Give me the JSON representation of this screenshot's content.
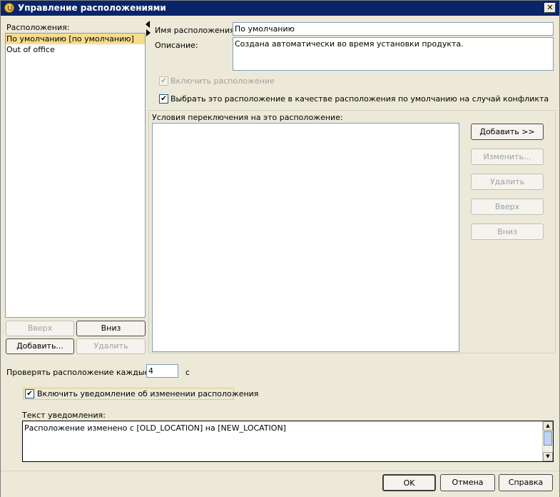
{
  "window": {
    "title": "Управление расположениями"
  },
  "locations": {
    "label": "Расположения:",
    "items": [
      "По умолчанию [по умолчанию]",
      "Out of office"
    ],
    "up_label": "Вверх",
    "down_label": "Вниз",
    "add_label": "Добавить...",
    "delete_label": "Удалить"
  },
  "details": {
    "name_label": "Имя расположения:",
    "name_value": "По умолчанию",
    "desc_label": "Описание:",
    "desc_value": "Создана автоматически во время установки продукта.",
    "enable_label": "Включить расположение",
    "enable_checked": "✔",
    "default_label": "Выбрать это расположение в качестве расположения по умолчанию на случай конфликта",
    "default_checked": "✔"
  },
  "conditions": {
    "label": "Условия переключения на это расположение:",
    "add_label": "Добавить >>",
    "edit_label": "Изменить...",
    "delete_label": "Удалить",
    "up_label": "Вверх",
    "down_label": "Вниз"
  },
  "check_interval": {
    "label": "Проверять расположение каждые:",
    "value": "4",
    "unit": "с"
  },
  "notify": {
    "enable_label": "Включить уведомление об изменении расположения",
    "enable_checked": "✔",
    "text_label": "Текст уведомления:",
    "text_value": "Расположение изменено с [OLD_LOCATION] на [NEW_LOCATION]"
  },
  "footer": {
    "ok_label": "OK",
    "cancel_label": "Отмена",
    "help_label": "Справка"
  },
  "colors": {
    "title_bar": "#0a246a",
    "selection": "#f7dc8f",
    "dialog_bg": "#ece9d8"
  }
}
